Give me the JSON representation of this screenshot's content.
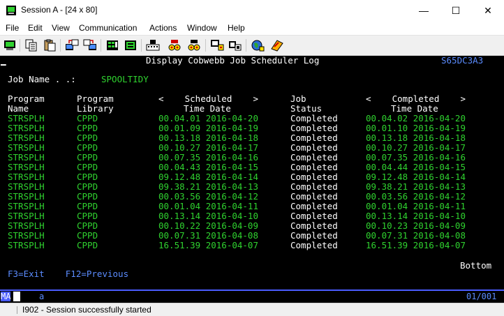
{
  "window": {
    "title": "Session A - [24 x 80]",
    "minimize_glyph": "—",
    "maximize_glyph": "☐",
    "close_glyph": "✕"
  },
  "menu": [
    "File",
    "Edit",
    "View",
    "Communication",
    "Actions",
    "Window",
    "Help"
  ],
  "toolbar": {
    "buttons": [
      "print-screen-icon",
      "copy-icon",
      "paste-icon",
      "send-file-icon",
      "receive-file-icon",
      "display-keypad-icon",
      "keyboard-map-icon",
      "record-macro-icon",
      "stop-macro-icon",
      "play-macro-icon",
      "macro-list-icon",
      "customize-icon",
      "help-icon"
    ]
  },
  "terminal": {
    "header_title": "Display Cobwebb Job Scheduler Log",
    "system_name": "S65DC3A3",
    "job_name_label": "Job Name . .:",
    "job_name_value": "SPOOLTIDY",
    "col_headers": {
      "program_l1": "Program",
      "program_l2": "Name",
      "library_l1": "Program",
      "library_l2": "Library",
      "sched_l1": "<    Scheduled    >",
      "sched_l2": "Time Date",
      "status_l1": "Job",
      "status_l2": "Status",
      "comp_l1": "<    Completed    >",
      "comp_l2": "Time Date"
    },
    "rows": [
      {
        "program": "STRSPLH",
        "library": "CPPD",
        "sched": "00.04.01 2016-04-20",
        "status": "Completed",
        "completed": "00.04.02 2016-04-20"
      },
      {
        "program": "STRSPLH",
        "library": "CPPD",
        "sched": "00.01.09 2016-04-19",
        "status": "Completed",
        "completed": "00.01.10 2016-04-19"
      },
      {
        "program": "STRSPLH",
        "library": "CPPD",
        "sched": "00.13.18 2016-04-18",
        "status": "Completed",
        "completed": "00.13.18 2016-04-18"
      },
      {
        "program": "STRSPLH",
        "library": "CPPD",
        "sched": "00.10.27 2016-04-17",
        "status": "Completed",
        "completed": "00.10.27 2016-04-17"
      },
      {
        "program": "STRSPLH",
        "library": "CPPD",
        "sched": "00.07.35 2016-04-16",
        "status": "Completed",
        "completed": "00.07.35 2016-04-16"
      },
      {
        "program": "STRSPLH",
        "library": "CPPD",
        "sched": "00.04.43 2016-04-15",
        "status": "Completed",
        "completed": "00.04.44 2016-04-15"
      },
      {
        "program": "STRSPLH",
        "library": "CPPD",
        "sched": "09.12.48 2016-04-14",
        "status": "Completed",
        "completed": "09.12.48 2016-04-14"
      },
      {
        "program": "STRSPLH",
        "library": "CPPD",
        "sched": "09.38.21 2016-04-13",
        "status": "Completed",
        "completed": "09.38.21 2016-04-13"
      },
      {
        "program": "STRSPLH",
        "library": "CPPD",
        "sched": "00.03.56 2016-04-12",
        "status": "Completed",
        "completed": "00.03.56 2016-04-12"
      },
      {
        "program": "STRSPLH",
        "library": "CPPD",
        "sched": "00.01.04 2016-04-11",
        "status": "Completed",
        "completed": "00.01.04 2016-04-11"
      },
      {
        "program": "STRSPLH",
        "library": "CPPD",
        "sched": "00.13.14 2016-04-10",
        "status": "Completed",
        "completed": "00.13.14 2016-04-10"
      },
      {
        "program": "STRSPLH",
        "library": "CPPD",
        "sched": "00.10.22 2016-04-09",
        "status": "Completed",
        "completed": "00.10.23 2016-04-09"
      },
      {
        "program": "STRSPLH",
        "library": "CPPD",
        "sched": "00.07.31 2016-04-08",
        "status": "Completed",
        "completed": "00.07.31 2016-04-08"
      },
      {
        "program": "STRSPLH",
        "library": "CPPD",
        "sched": "16.51.39 2016-04-07",
        "status": "Completed",
        "completed": "16.51.39 2016-04-07"
      }
    ],
    "bottom_indicator": "Bottom",
    "fkeys": "F3=Exit    F12=Previous"
  },
  "oia": {
    "mode": "MA",
    "indicator": "a",
    "cursor_pos": "01/001"
  },
  "status": {
    "message": "I902 - Session successfully started"
  }
}
